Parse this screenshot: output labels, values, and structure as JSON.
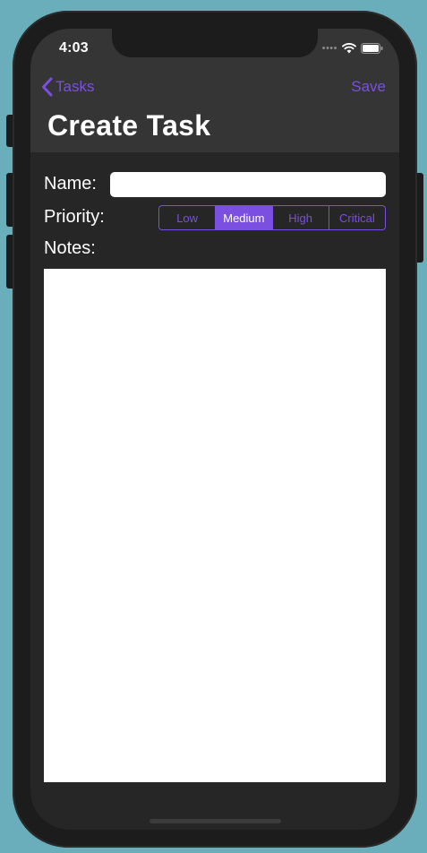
{
  "status_bar": {
    "time": "4:03"
  },
  "nav": {
    "back_label": "Tasks",
    "save_label": "Save",
    "title": "Create Task"
  },
  "form": {
    "name_label": "Name:",
    "name_value": "",
    "priority_label": "Priority:",
    "priority_options": [
      "Low",
      "Medium",
      "High",
      "Critical"
    ],
    "priority_selected": "Medium",
    "notes_label": "Notes:",
    "notes_value": ""
  },
  "colors": {
    "accent": "#7b4fe0",
    "background": "#262626",
    "nav_background": "#353535",
    "page_background": "#6aaebb"
  },
  "icons": {
    "back": "chevron-left-icon",
    "signal": "cellular-signal-icon",
    "wifi": "wifi-icon",
    "battery": "battery-icon"
  }
}
